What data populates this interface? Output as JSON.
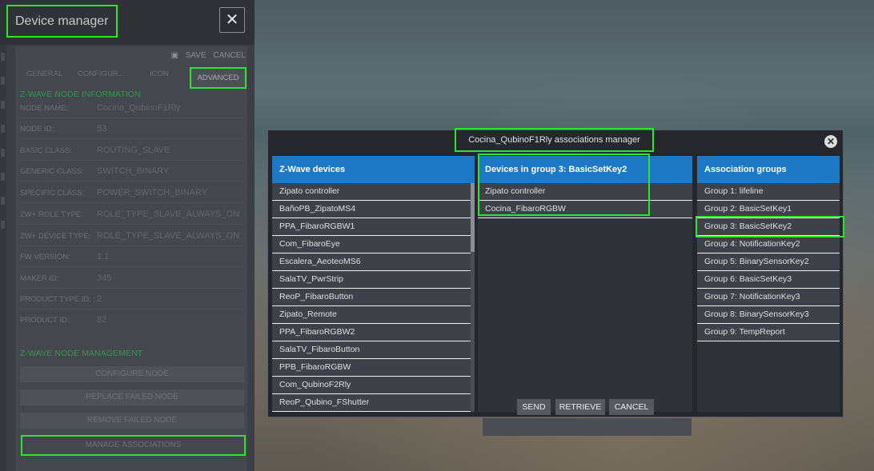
{
  "app": {
    "title": "Device manager",
    "tool_icon": "wrench-screwdriver-icon"
  },
  "form": {
    "actions": {
      "save": "SAVE",
      "cancel": "CANCEL",
      "save_icon": "floppy-disk-icon"
    },
    "tabs": [
      "GENERAL",
      "CONFIGUR...",
      "ICON",
      "ADVANCED"
    ],
    "info_title": "Z-WAVE NODE INFORMATION",
    "info": [
      {
        "label": "NODE NAME:",
        "value": "Cocina_QubinoF1Rly"
      },
      {
        "label": "NODE ID:",
        "value": "53"
      },
      {
        "label": "BASIC CLASS:",
        "value": "ROUTING_SLAVE"
      },
      {
        "label": "GENERIC CLASS:",
        "value": "SWITCH_BINARY"
      },
      {
        "label": "SPECIFIC CLASS:",
        "value": "POWER_SWITCH_BINARY"
      },
      {
        "label": "ZW+ ROLE TYPE:",
        "value": "ROLE_TYPE_SLAVE_ALWAYS_ON"
      },
      {
        "label": "ZW+ DEVICE TYPE:",
        "value": "ROLE_TYPE_SLAVE_ALWAYS_ON"
      },
      {
        "label": "FW VERSION:",
        "value": "1.1"
      },
      {
        "label": "MAKER ID:",
        "value": "345"
      },
      {
        "label": "PRODUCT TYPE ID:",
        "value": "2"
      },
      {
        "label": "PRODUCT ID:",
        "value": "82"
      }
    ],
    "mgmt_title": "Z-WAVE NODE MANAGEMENT",
    "mgmt_buttons": [
      "CONFIGURE NODE",
      "REPLACE FAILED NODE",
      "REMOVE FAILED NODE",
      "MANAGE ASSOCIATIONS"
    ]
  },
  "modal": {
    "title": "Cocina_QubinoF1Rly associations manager",
    "close_icon": "close-circle-icon",
    "devices_header": "Z-Wave devices",
    "devices": [
      "Zipato controller",
      "BañoPB_ZipatoMS4",
      "PPA_FibaroRGBW1",
      "Com_FibaroEye",
      "Escalera_AeoteoMS6",
      "SalaTV_PwrStrip",
      "ReoP_FibaroButton",
      "Zipato_Remote",
      "PPA_FibaroRGBW2",
      "SalaTV_FibaroButton",
      "PPB_FibaroRGBW",
      "Com_QubinoF2Rly",
      "ReoP_Qubino_FShutter"
    ],
    "group_devices_header": "Devices in group 3: BasicSetKey2",
    "group_devices": [
      "Zipato controller",
      "Cocina_FibaroRGBW"
    ],
    "buttons": {
      "send": "SEND",
      "retrieve": "RETRIEVE",
      "cancel": "CANCEL"
    },
    "groups_header": "Association groups",
    "groups": [
      "Group 1: lifeline",
      "Group 2: BasicSetKey1",
      "Group 3: BasicSetKey2",
      "Group 4: NotificationKey2",
      "Group 5: BinarySensorKey2",
      "Group 6: BasicSetKey3",
      "Group 7: NotificationKey3",
      "Group 8: BinarySensorKey3",
      "Group 9: TempReport"
    ],
    "selected_group": "Group 3: BasicSetKey2"
  },
  "colors": {
    "highlight": "#2ee52e",
    "header_blue": "#1d79c5",
    "section_green": "#2e9c4a"
  }
}
